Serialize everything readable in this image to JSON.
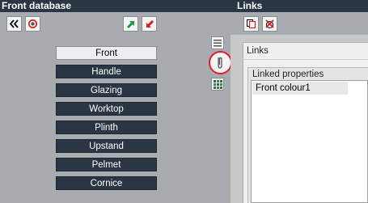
{
  "header": {
    "left_title": "Front database",
    "right_title": "Links"
  },
  "front_items": [
    {
      "label": "Front",
      "active": true
    },
    {
      "label": "Handle",
      "active": false
    },
    {
      "label": "Glazing",
      "active": false
    },
    {
      "label": "Worktop",
      "active": false
    },
    {
      "label": "Plinth",
      "active": false
    },
    {
      "label": "Upstand",
      "active": false
    },
    {
      "label": "Pelmet",
      "active": false
    },
    {
      "label": "Cornice",
      "active": false
    }
  ],
  "links_panel": {
    "title": "Links",
    "group_label": "Linked properties",
    "linked_properties": [
      "Front colour1"
    ]
  },
  "icons": {
    "collapse": "double-chevron-left-icon",
    "target": "target-icon",
    "export": "arrow-up-right-icon",
    "import": "arrow-down-left-icon",
    "copy": "copy-link-icon",
    "delete": "delete-link-icon",
    "list_view": "list-view-icon",
    "clip_view": "paperclip-icon",
    "grid_view": "grid-view-icon"
  },
  "colors": {
    "header_bg": "#2b3644",
    "item_bg": "#2b3644",
    "highlight_ring": "#e0202a",
    "export_green": "#1a9a3a",
    "import_red": "#d42020"
  }
}
